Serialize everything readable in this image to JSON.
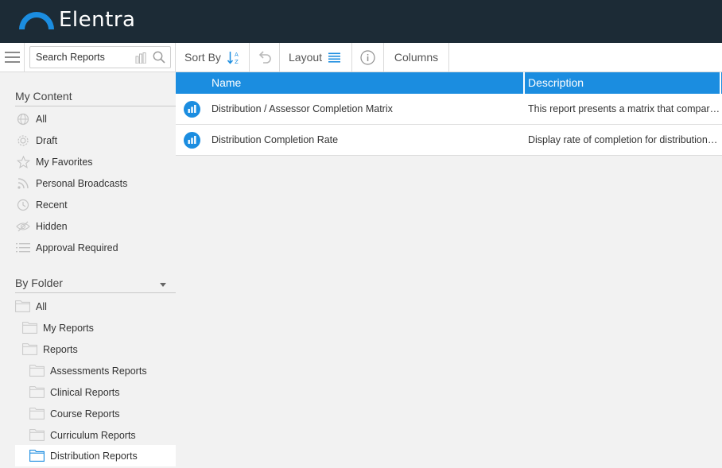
{
  "app": {
    "brand": "Elentra"
  },
  "toolbar": {
    "search_placeholder": "Search Reports",
    "sort_label": "Sort By",
    "layout_label": "Layout",
    "columns_label": "Columns"
  },
  "sidebar": {
    "my_content_title": "My Content",
    "my_content_items": [
      {
        "label": "All",
        "icon": "globe-icon"
      },
      {
        "label": "Draft",
        "icon": "gear-icon"
      },
      {
        "label": "My Favorites",
        "icon": "star-icon"
      },
      {
        "label": "Personal Broadcasts",
        "icon": "rss-icon"
      },
      {
        "label": "Recent",
        "icon": "clock-icon"
      },
      {
        "label": "Hidden",
        "icon": "eye-slash-icon"
      },
      {
        "label": "Approval Required",
        "icon": "list-icon"
      }
    ],
    "by_folder_title": "By Folder",
    "folders": [
      {
        "label": "All",
        "level": 0
      },
      {
        "label": "My Reports",
        "level": 1
      },
      {
        "label": "Reports",
        "level": 1
      },
      {
        "label": "Assessments Reports",
        "level": 2
      },
      {
        "label": "Clinical Reports",
        "level": 2
      },
      {
        "label": "Course Reports",
        "level": 2
      },
      {
        "label": "Curriculum Reports",
        "level": 2
      },
      {
        "label": "Distribution Reports",
        "level": 2,
        "selected": true
      }
    ]
  },
  "grid": {
    "columns": [
      "Name",
      "Description"
    ],
    "rows": [
      {
        "name": "Distribution / Assessor Completion Matrix",
        "description": "This report presents a matrix that compares distributions with assessors and their completion status."
      },
      {
        "name": "Distribution Completion Rate",
        "description": "Display rate of completion for distributions over a selected period."
      }
    ]
  },
  "colors": {
    "header_bg": "#1c2b36",
    "accent": "#1b8de0",
    "brand_arc": "#1b8de0"
  }
}
